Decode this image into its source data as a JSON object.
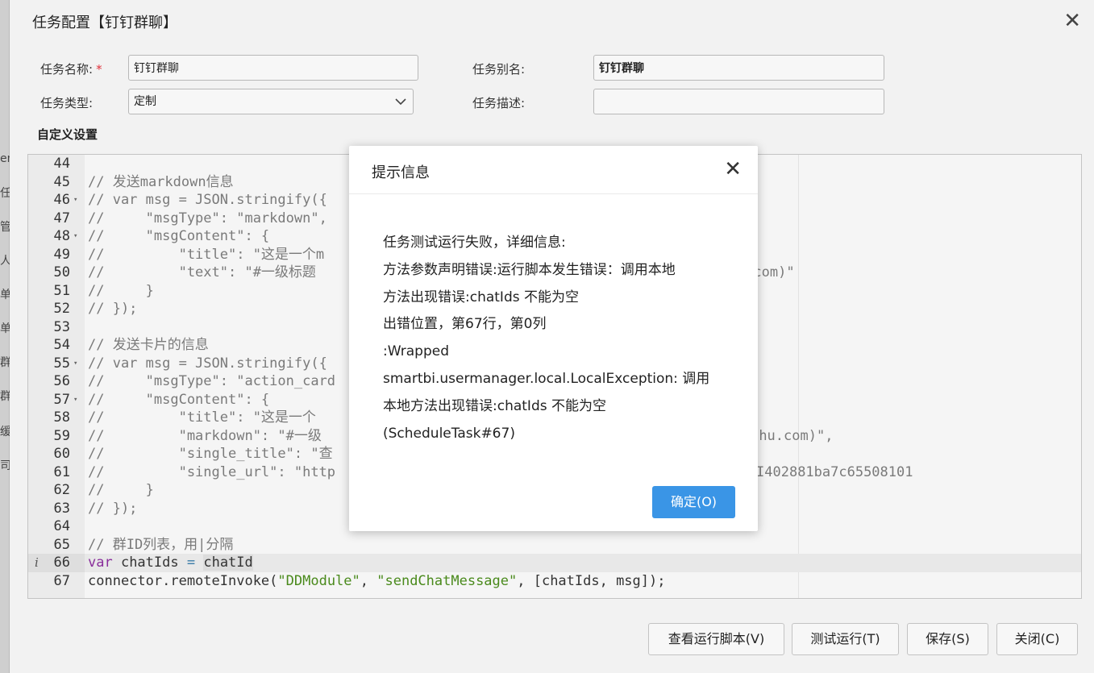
{
  "background": {
    "fragments": [
      "en",
      "任",
      "管",
      "人",
      "单",
      "单",
      "群",
      "群",
      "缓",
      "司"
    ]
  },
  "dialog": {
    "title": "任务配置【钉钉群聊】",
    "close_glyph": "✕",
    "form": {
      "task_name_label": "任务名称:",
      "required_mark": "*",
      "task_name_value": "钉钉群聊",
      "task_alias_label": "任务别名:",
      "task_alias_value": "钉钉群聊",
      "task_type_label": "任务类型:",
      "task_type_value": "定制",
      "task_desc_label": "任务描述:",
      "task_desc_value": ""
    },
    "custom_settings_label": "自定义设置"
  },
  "editor": {
    "lines": [
      {
        "n": "44",
        "fold": "",
        "html": ""
      },
      {
        "n": "45",
        "fold": "",
        "html": "<span class='c-comment'>// 发送markdown信息</span>"
      },
      {
        "n": "46",
        "fold": "▾",
        "html": "<span class='c-comment'>// var msg = JSON.stringify({</span>"
      },
      {
        "n": "47",
        "fold": "",
        "html": "<span class='c-comment'>//     \"msgType\": \"markdown\",</span>"
      },
      {
        "n": "48",
        "fold": "▾",
        "html": "<span class='c-comment'>//     \"msgContent\": {</span>"
      },
      {
        "n": "49",
        "fold": "",
        "html": "<span class='c-comment'>//         \"title\": \"这是一个m</span>"
      },
      {
        "n": "50",
        "fold": "",
        "html": "<span class='c-comment'>//         \"text\": \"#一级标题                                   ttp://www.jianshu.com)\"</span>"
      },
      {
        "n": "51",
        "fold": "",
        "html": "<span class='c-comment'>//     }</span>"
      },
      {
        "n": "52",
        "fold": "",
        "html": "<span class='c-comment'>// });</span>"
      },
      {
        "n": "53",
        "fold": "",
        "html": ""
      },
      {
        "n": "54",
        "fold": "",
        "html": "<span class='c-comment'>// 发送卡片的信息</span>"
      },
      {
        "n": "55",
        "fold": "▾",
        "html": "<span class='c-comment'>// var msg = JSON.stringify({</span>"
      },
      {
        "n": "56",
        "fold": "",
        "html": "<span class='c-comment'>//     \"msgType\": \"action_card</span>"
      },
      {
        "n": "57",
        "fold": "▾",
        "html": "<span class='c-comment'>//     \"msgContent\": {</span>"
      },
      {
        "n": "58",
        "fold": "",
        "html": "<span class='c-comment'>//         \"title\": \"这是一个</span>"
      },
      {
        "n": "59",
        "fold": "",
        "html": "<span class='c-comment'>//         \"markdown\": \"#一级                                   ](http://www.jianshu.com)\",</span>"
      },
      {
        "n": "60",
        "fold": "",
        "html": "<span class='c-comment'>//         \"single_title\": \"查</span>"
      },
      {
        "n": "61",
        "fold": "",
        "html": "<span class='c-comment'>//         \"single_url\": \"http                                  source.jsp?resid=I402881ba7c65508101</span>"
      },
      {
        "n": "62",
        "fold": "",
        "html": "<span class='c-comment'>//     }</span>"
      },
      {
        "n": "63",
        "fold": "",
        "html": "<span class='c-comment'>// });</span>"
      },
      {
        "n": "64",
        "fold": "",
        "html": ""
      },
      {
        "n": "65",
        "fold": "",
        "html": "<span class='c-comment'>// 群ID列表，用|分隔</span>"
      },
      {
        "n": "66",
        "fold": "",
        "info": "i",
        "active": true,
        "html": "<span class='c-kw'>var</span> chatIds <span class='c-op'>=</span> <span class='c-hl'>chatId</span>"
      },
      {
        "n": "67",
        "fold": "",
        "html": "connector.remoteInvoke(<span class='c-str'>\"DDModule\"</span>, <span class='c-str'>\"sendChatMessage\"</span>, [chatIds, msg]);"
      }
    ]
  },
  "buttons": {
    "view_script": "查看运行脚本(V)",
    "test_run": "测试运行(T)",
    "save": "保存(S)",
    "close": "关闭(C)"
  },
  "message_box": {
    "title": "提示信息",
    "close_glyph": "✕",
    "lines": [
      "任务测试运行失败，详细信息:",
      "方法参数声明错误:运行脚本发生错误：调用本地",
      "方法出现错误:chatIds 不能为空",
      "出错位置，第67行，第0列",
      ":Wrapped",
      "smartbi.usermanager.local.LocalException: 调用",
      "本地方法出现错误:chatIds 不能为空",
      "(ScheduleTask#67)"
    ],
    "ok_label": "确定(O)"
  },
  "colors": {
    "primary": "#3a95e6",
    "required": "#e0303a",
    "comment": "#7a7a7a",
    "keyword": "#8a2f9c",
    "string": "#4a8a1c"
  }
}
